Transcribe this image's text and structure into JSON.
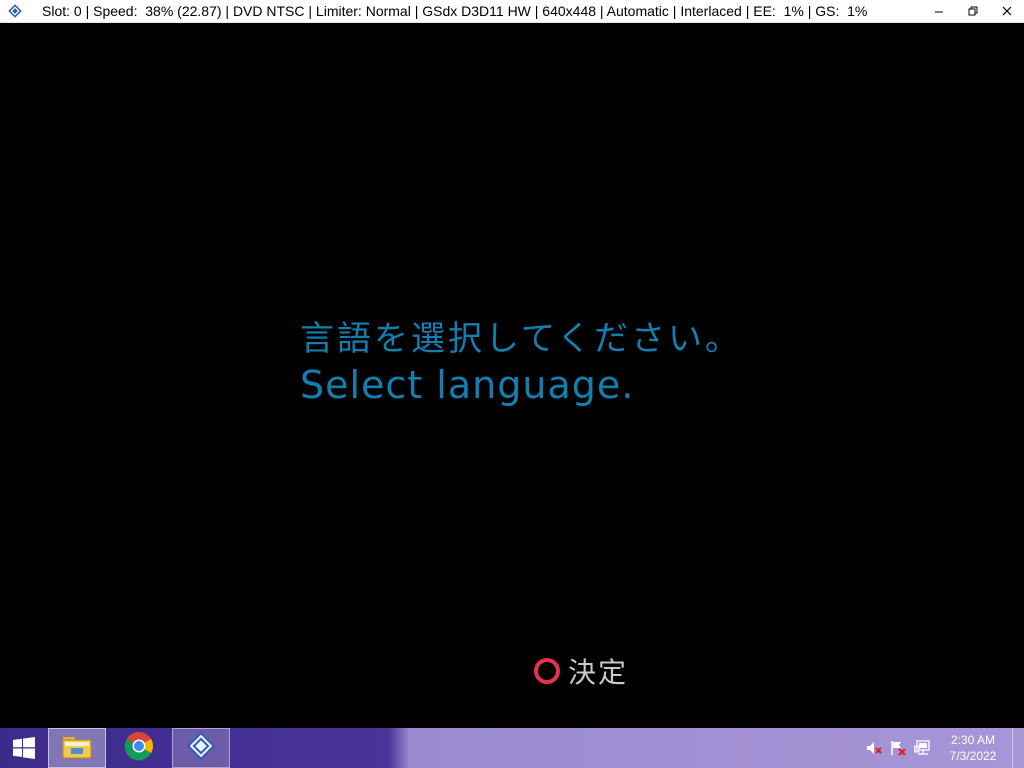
{
  "window": {
    "title": "Slot: 0 | Speed:  38% (22.87) | DVD NTSC | Limiter: Normal | GSdx D3D11 HW | 640x448 | Automatic | Interlaced | EE:  1% | GS:  1%",
    "minimize_icon": "minimize-icon",
    "restore_icon": "restore-icon",
    "close_icon": "close-icon"
  },
  "game": {
    "prompt_jp": "言語を選択してください。",
    "prompt_en": "Select language.",
    "confirm_label": "決定",
    "confirm_icon": "circle-button-icon",
    "text_color": "#127fb0",
    "circle_color": "#e5344a"
  },
  "taskbar": {
    "start_icon": "windows-start-icon",
    "items": [
      {
        "name": "file-explorer",
        "icon": "folder-icon",
        "active": true
      },
      {
        "name": "chrome",
        "icon": "chrome-icon",
        "active": false
      },
      {
        "name": "pcsx2",
        "icon": "pcsx2-icon",
        "active": true
      }
    ],
    "tray_icons": [
      "speaker-muted-icon",
      "action-center-flag-icon",
      "network-icon"
    ],
    "clock_time": "2:30 AM",
    "clock_date": "7/3/2022"
  }
}
